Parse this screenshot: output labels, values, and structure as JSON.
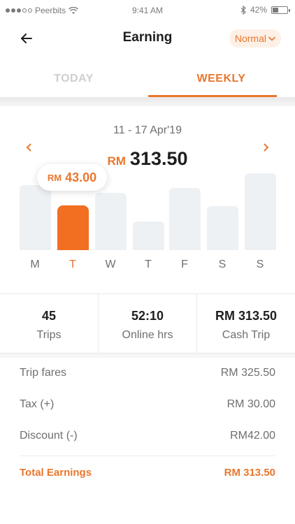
{
  "status_bar": {
    "carrier": "Peerbits",
    "time": "9:41 AM",
    "battery": "42%",
    "battery_level": 0.42
  },
  "header": {
    "title": "Earning",
    "mode": "Normal"
  },
  "tabs": [
    {
      "label": "TODAY",
      "active": false
    },
    {
      "label": "WEEKLY",
      "active": true
    }
  ],
  "week": {
    "range": "11 - 17 Apr'19",
    "currency": "RM",
    "total": "313.50"
  },
  "tooltip": {
    "currency": "RM",
    "amount": "43.00"
  },
  "chart_data": {
    "type": "bar",
    "categories": [
      "M",
      "T",
      "W",
      "T",
      "F",
      "S",
      "S"
    ],
    "values": [
      95,
      65,
      83,
      42,
      90,
      64,
      112
    ],
    "selected_index": 1,
    "ylim": [
      0,
      120
    ]
  },
  "summary": [
    {
      "value": "45",
      "label": "Trips"
    },
    {
      "value": "52:10",
      "label": "Online hrs"
    },
    {
      "value": "RM 313.50",
      "label": "Cash Trip"
    }
  ],
  "breakdown": [
    {
      "label": "Trip fares",
      "value": "RM 325.50"
    },
    {
      "label": "Tax (+)",
      "value": "RM 30.00"
    },
    {
      "label": "Discount (-)",
      "value": "RM42.00"
    }
  ],
  "total": {
    "label": "Total Earnings",
    "value": "RM 313.50"
  },
  "colors": {
    "accent": "#e8772e",
    "bar_active": "#f26f21",
    "bar_inactive": "#eef1f4"
  }
}
